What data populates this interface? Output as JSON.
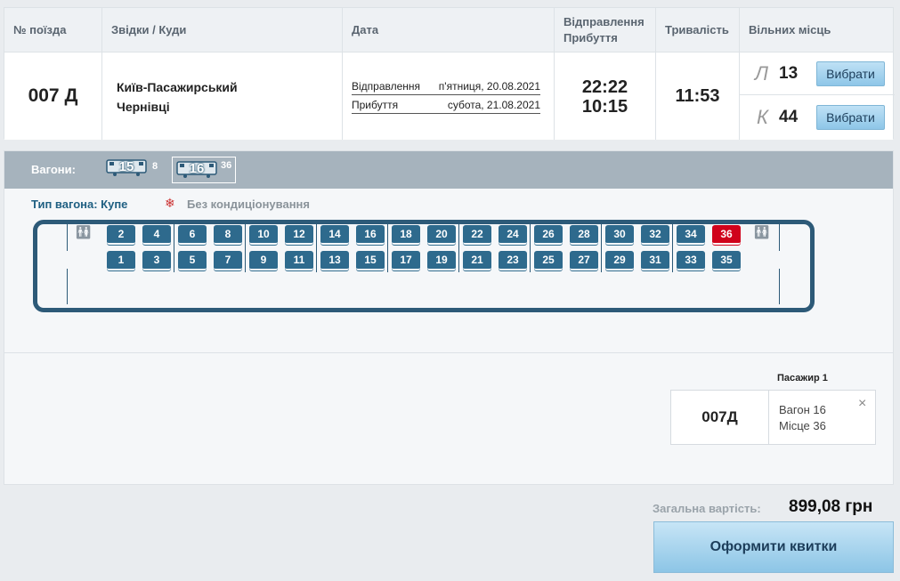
{
  "table": {
    "headers": {
      "train_no": "№ поїзда",
      "route": "Звідки / Куди",
      "date": "Дата",
      "dep_arr_1": "Відправлення",
      "dep_arr_2": "Прибуття",
      "duration": "Тривалість",
      "free_seats": "Вільних місць"
    },
    "row": {
      "train_no": "007 Д",
      "from": "Київ-Пасажирський",
      "to": "Чернівці",
      "dep_label": "Відправлення",
      "dep_date": "п'ятниця, 20.08.2021",
      "arr_label": "Прибуття",
      "arr_date": "субота, 21.08.2021",
      "dep_time": "22:22",
      "arr_time": "10:15",
      "duration": "11:53",
      "seat_classes": [
        {
          "letter": "Л",
          "count": "13",
          "button": "Вибрати"
        },
        {
          "letter": "К",
          "count": "44",
          "button": "Вибрати"
        }
      ]
    }
  },
  "wagons": {
    "label": "Вагони:",
    "items": [
      {
        "number": "15",
        "free": "8",
        "selected": false
      },
      {
        "number": "16",
        "free": "36",
        "selected": true
      }
    ],
    "type_label": "Тип вагона: Купе",
    "ac_label": "Без кондиціонування",
    "upper_seats": [
      "2",
      "4",
      "6",
      "8",
      "10",
      "12",
      "14",
      "16",
      "18",
      "20",
      "22",
      "24",
      "26",
      "28",
      "30",
      "32",
      "34",
      "36"
    ],
    "lower_seats": [
      "1",
      "3",
      "5",
      "7",
      "9",
      "11",
      "13",
      "15",
      "17",
      "19",
      "21",
      "23",
      "25",
      "27",
      "29",
      "31",
      "33",
      "35"
    ],
    "selected_seat": "36"
  },
  "ticket": {
    "passenger_label": "Пасажир 1",
    "train": "007Д",
    "wagon": "Вагон 16",
    "seat": "Місце 36",
    "close": "×"
  },
  "summary": {
    "total_label": "Загальна вартість:",
    "total_value": "899,08 грн",
    "order_button": "Оформити квитки"
  },
  "colors": {
    "seat": "#2e6a8d",
    "seat_selected": "#d0021b",
    "wagon_bar": "#a6b3bd"
  }
}
